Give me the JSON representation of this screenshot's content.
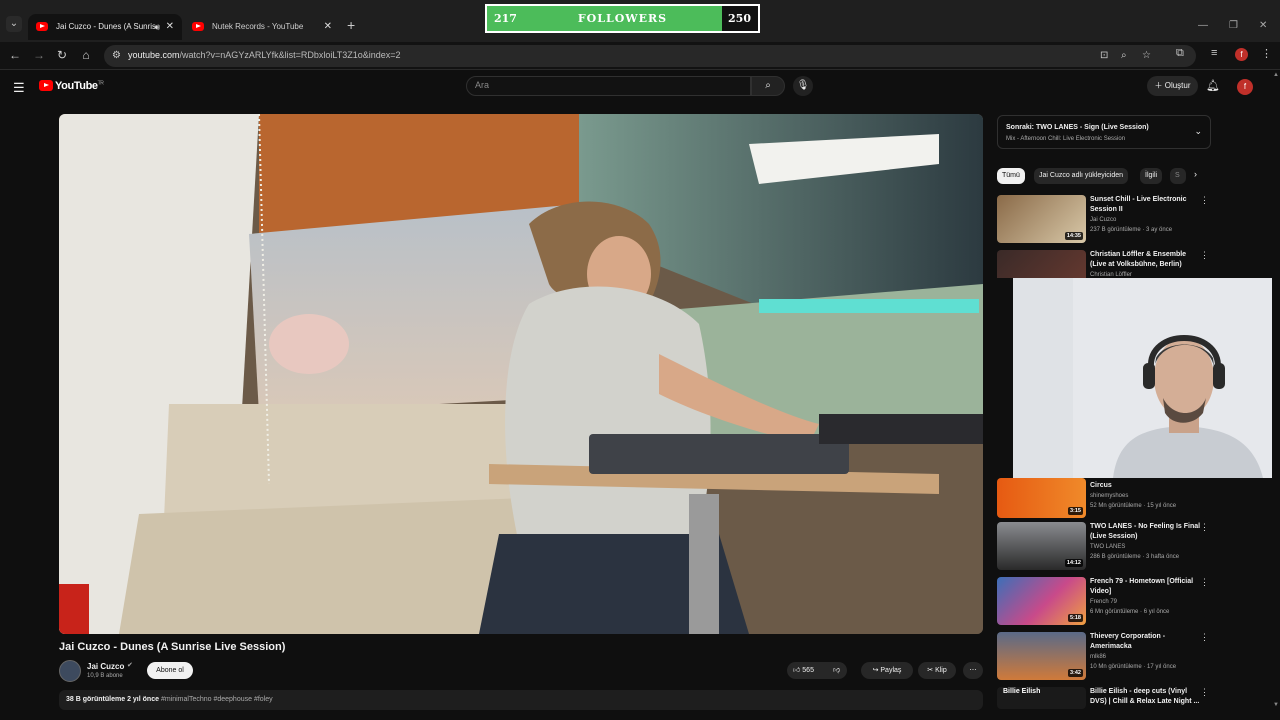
{
  "browser": {
    "tabs": [
      {
        "label": "Jai Cuzco - Dunes (A Sunris",
        "active": true
      },
      {
        "label": "Nutek Records - YouTube",
        "active": false
      }
    ],
    "new_tab_label": "+",
    "url_prefix": "youtube.com",
    "url_rest": "/watch?v=nAGYzARLYfk&list=RDbxloiLT3Z1o&index=2",
    "profile_initial": "f"
  },
  "followers_overlay": {
    "current": "217",
    "label": "FOLLOWERS",
    "goal": "250",
    "progress": 0.868,
    "bar_color": "#4cbc5a"
  },
  "youtube": {
    "logo_text": "YouTube",
    "region": "TR",
    "search_placeholder": "Ara",
    "create_label": "Oluştur",
    "avatar_initial": "f"
  },
  "video": {
    "title": "Jai Cuzco - Dunes (A Sunrise Live Session)",
    "channel": "Jai Cuzco",
    "subscribers": "10,9 B abone",
    "subscribe_label": "Abone ol",
    "likes": "565",
    "share_label": "Paylaş",
    "clip_label": "Klip",
    "views": "38 B görüntüleme",
    "age": "2 yıl önce",
    "tags": "#minimalTechno #deephouse #foley"
  },
  "sidebar": {
    "up_next_title": "Sonraki: TWO LANES - Sign (Live Session)",
    "up_next_sub": "Mix - Afternoon Chill: Live Electronic Session",
    "chips": [
      "Tümü",
      "Jai Cuzco adlı yükleyiciden",
      "İlgili",
      "S"
    ],
    "items": [
      {
        "title": "Sunset Chill - Live Electronic Session II",
        "channel": "Jai Cuzco",
        "meta": "237 B görüntüleme · 3 ay önce",
        "duration": "14:35"
      },
      {
        "title": "Christian Löffler & Ensemble (Live at Volksbühne, Berlin)",
        "channel": "Christian Löffler",
        "meta": "",
        "duration": ""
      },
      {
        "title": "Circus",
        "channel": "shinemyshoes",
        "meta": "52 Mn görüntüleme · 15 yıl önce",
        "duration": "3:15"
      },
      {
        "title": "TWO LANES - No Feeling Is Final (Live Session)",
        "channel": "TWO LANES",
        "meta": "286 B görüntüleme · 3 hafta önce",
        "duration": "14:12"
      },
      {
        "title": "French 79 - Hometown [Official Video]",
        "channel": "French 79",
        "meta": "6 Mn görüntüleme · 6 yıl önce",
        "duration": "5:18"
      },
      {
        "title": "Thievery Corporation - Amerimacka",
        "channel": "mlk86",
        "meta": "10 Mn görüntüleme · 17 yıl önce",
        "duration": "3:42"
      },
      {
        "title": "Billie Eilish - deep cuts (Vinyl DVS) | Chill & Relax Late Night ...",
        "channel": "",
        "meta": "",
        "duration": "",
        "thumb_text": "Billie Eilish"
      }
    ]
  },
  "colors": {
    "page_bg": "#0f0f0f",
    "yt_red": "#ff0000",
    "chip_bg": "#272727"
  }
}
